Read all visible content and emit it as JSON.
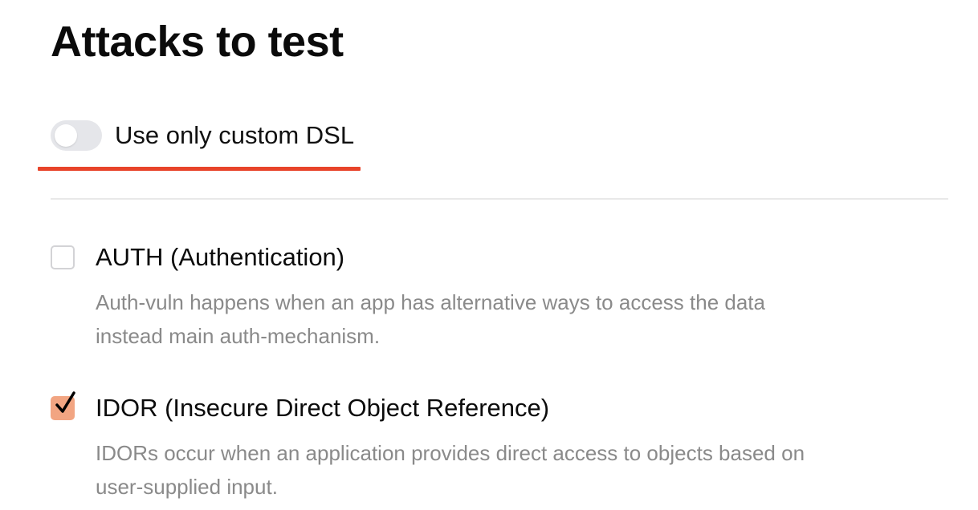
{
  "page": {
    "title": "Attacks to test"
  },
  "custom_dsl_toggle": {
    "label": "Use only custom DSL",
    "state": "off",
    "highlight_color": "#e8442a"
  },
  "attacks": [
    {
      "name": "AUTH (Authentication)",
      "checked": false,
      "description_line1": "Auth-vuln happens when an app has alternative ways to access the data",
      "description_line2": "instead main auth-mechanism."
    },
    {
      "name": "IDOR (Insecure Direct Object Reference)",
      "checked": true,
      "description_line1": "IDORs occur when an application provides direct access to objects based on",
      "description_line2": "user-supplied input."
    }
  ],
  "colors": {
    "checkbox_checked": "#f2a582",
    "toggle_off": "#e5e6ea",
    "description_text": "#8a8a8a"
  },
  "icons": {
    "toggle": "toggle-switch-icon",
    "checkbox_checked": "checkmark-icon"
  }
}
